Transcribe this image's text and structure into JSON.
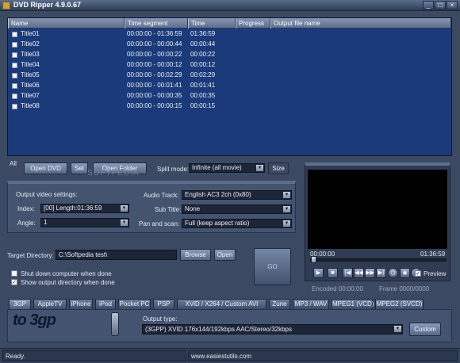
{
  "window": {
    "title": "DVD Ripper 4.9.0.67"
  },
  "list": {
    "columns": [
      "Name",
      "Time segment",
      "Time",
      "Progress",
      "Output file name"
    ],
    "rows": [
      {
        "name": "Title01",
        "segment": "00:00:00 - 01:36:59",
        "time": "01:36:59"
      },
      {
        "name": "Title02",
        "segment": "00:00:00 - 00:00:44",
        "time": "00:00:44"
      },
      {
        "name": "Title03",
        "segment": "00:00:00 - 00:00:22",
        "time": "00:00:22"
      },
      {
        "name": "Title04",
        "segment": "00:00:00 - 00:00:12",
        "time": "00:00:12"
      },
      {
        "name": "Title05",
        "segment": "00:00:00 - 00:02:29",
        "time": "00:02:29"
      },
      {
        "name": "Title06",
        "segment": "00:00:00 - 00:01:41",
        "time": "00:01:41"
      },
      {
        "name": "Title07",
        "segment": "00:00:00 - 00:00:35",
        "time": "00:00:35"
      },
      {
        "name": "Title08",
        "segment": "00:00:00 - 00:00:15",
        "time": "00:00:15"
      }
    ]
  },
  "toolbar": {
    "all_label": "All",
    "open_dvd": "Open DVD",
    "set": "Set",
    "open_folder": "Open Folder",
    "split_mode_label": "Split mode:",
    "split_mode_value": "Infinite (all movie)",
    "size": "Size",
    "watermark": "SOFTPEDIA"
  },
  "settings": {
    "header": "Output video settings:",
    "index_label": "Index:",
    "index_value": "[00] Length:01:36:59",
    "angle_label": "Angle:",
    "angle_value": "1",
    "audio_label": "Audio Track:",
    "audio_value": "English AC3 2ch (0x80)",
    "subtitle_label": "Sub Title:",
    "subtitle_value": "None",
    "pan_label": "Pan and scan:",
    "pan_value": "Full (keep aspect ratio)"
  },
  "target": {
    "label": "Target Directory:",
    "value": "C:\\Softpedia test\\",
    "browse": "Browse",
    "open": "Open",
    "go": "GO",
    "shutdown_label": "Shut down computer when done",
    "shutdown_checked": false,
    "show_output_label": "Show output directory when done",
    "show_output_checked": true
  },
  "preview": {
    "time_start": "00:00:00",
    "time_end": "01:36:59",
    "preview_label": "Preview",
    "preview_checked": true,
    "encoded": "Encoded 00:00:00",
    "frame": "Frame 0000/0000",
    "slider_position": 0.0
  },
  "tabs": [
    "3GP",
    "AppleTV",
    "iPhone",
    "iPod",
    "Pocket PC",
    "PSP",
    "XViD / X264 / Custom AVI",
    "Zune",
    "MP3 / WAV",
    "MPEG1 (VCD)",
    "MPEG2 (SVCD)"
  ],
  "active_tab": "3GP",
  "output": {
    "logo_text": "to 3gp",
    "type_label": "Output type:",
    "type_value": "(3GPP) XVID 176x144/192kbps  AAC/Stereo/32kbps",
    "custom": "Custom"
  },
  "status": {
    "state": "Ready.",
    "website": "www.easiestutils.com"
  },
  "colors": {
    "list_bg": "#1b3a7a",
    "window_bg": "#3b4a62",
    "video_bg": "#000000"
  }
}
